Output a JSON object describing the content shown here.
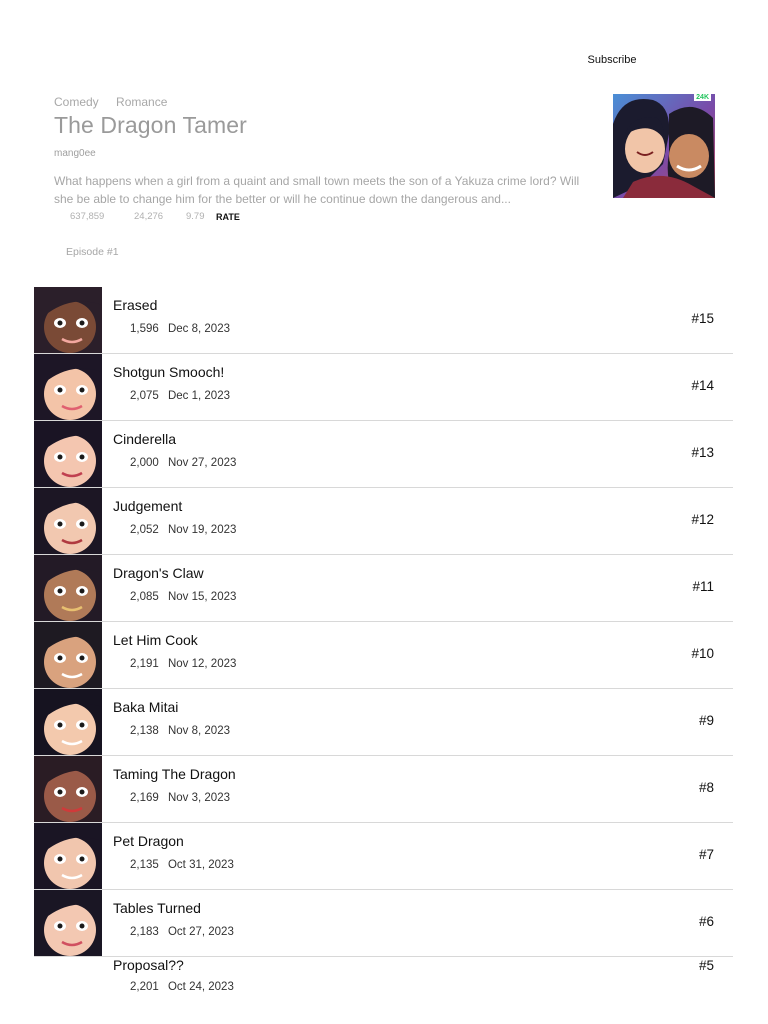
{
  "header": {
    "subscribe_label": "Subscribe"
  },
  "series": {
    "genres": [
      "Comedy",
      "Romance"
    ],
    "title": "The Dragon Tamer",
    "author": "mang0ee",
    "description": "What happens when a girl from a quaint and small town meets the son of a Yakuza crime lord? Will she be able to change him for the better or will he continue down the dangerous and...",
    "views": "637,859",
    "likes": "24,276",
    "rating": "9.79",
    "rate_label": "RATE",
    "first_episode_label": "Episode #1",
    "cover_badge": "24K"
  },
  "episodes": [
    {
      "title": "Erased",
      "views": "1,596",
      "date": "Dec 8, 2023",
      "number": "#15"
    },
    {
      "title": "Shotgun Smooch!",
      "views": "2,075",
      "date": "Dec 1, 2023",
      "number": "#14"
    },
    {
      "title": "Cinderella",
      "views": "2,000",
      "date": "Nov 27, 2023",
      "number": "#13"
    },
    {
      "title": "Judgement",
      "views": "2,052",
      "date": "Nov 19, 2023",
      "number": "#12"
    },
    {
      "title": "Dragon's Claw",
      "views": "2,085",
      "date": "Nov 15, 2023",
      "number": "#11"
    },
    {
      "title": "Let Him Cook",
      "views": "2,191",
      "date": "Nov 12, 2023",
      "number": "#10"
    },
    {
      "title": "Baka Mitai",
      "views": "2,138",
      "date": "Nov 8, 2023",
      "number": "#9"
    },
    {
      "title": "Taming The Dragon",
      "views": "2,169",
      "date": "Nov 3, 2023",
      "number": "#8"
    },
    {
      "title": "Pet Dragon",
      "views": "2,135",
      "date": "Oct 31, 2023",
      "number": "#7"
    },
    {
      "title": "Tables Turned",
      "views": "2,183",
      "date": "Oct 27, 2023",
      "number": "#6"
    },
    {
      "title": "Proposal??",
      "views": "2,201",
      "date": "Oct 24, 2023",
      "number": "#5"
    }
  ],
  "colors": {
    "muted_text": "#a6a6a6",
    "divider": "#d8d8d8",
    "badge_green": "#22c55e"
  }
}
